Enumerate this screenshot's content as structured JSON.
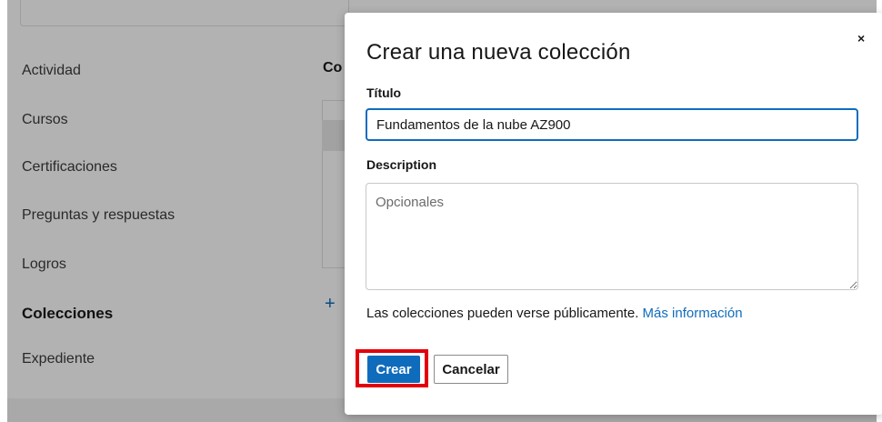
{
  "sidebar": {
    "items": [
      {
        "label": "Actividad"
      },
      {
        "label": "Cursos"
      },
      {
        "label": "Certificaciones"
      },
      {
        "label": "Preguntas y respuestas"
      },
      {
        "label": "Logros"
      },
      {
        "label": "Colecciones",
        "active": true
      },
      {
        "label": "Expediente"
      }
    ]
  },
  "main": {
    "heading_partial": "Co",
    "add_icon": "+"
  },
  "modal": {
    "title": "Crear una nueva colección",
    "close_icon": "×",
    "title_label": "Título",
    "title_value": "Fundamentos de la nube AZ900",
    "description_label": "Description",
    "description_placeholder": "Opcionales",
    "visibility_text": "Las colecciones pueden verse públicamente.",
    "more_info_link": "Más información",
    "create_button": "Crear",
    "cancel_button": "Cancelar"
  },
  "colors": {
    "accent": "#0f6cbd",
    "highlight": "#e3000b"
  }
}
